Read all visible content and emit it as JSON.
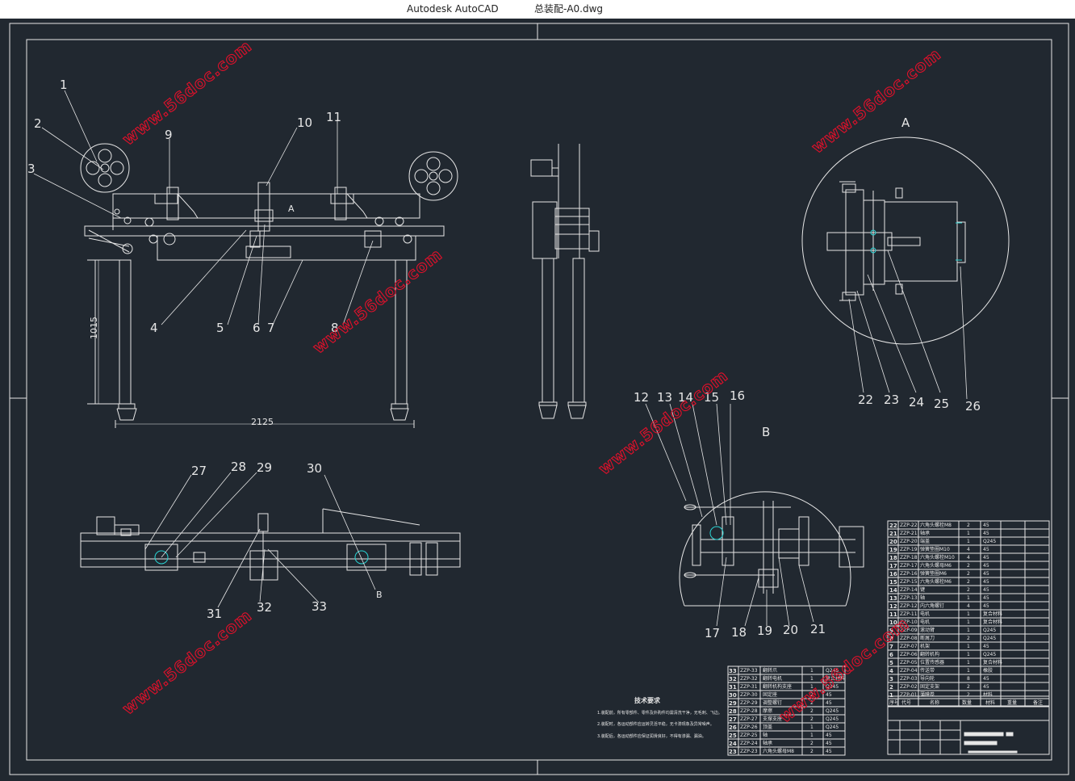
{
  "window": {
    "app_title": "Autodesk AutoCAD",
    "file_title": "总装配-A0.dwg"
  },
  "colors": {
    "background": "#212830",
    "line": "#e6e6e6",
    "accent": "#2ad4d4",
    "watermark": "#e0102a"
  },
  "watermark": {
    "text": "www.56doc.com"
  },
  "views": {
    "detail_a_label": "A",
    "detail_b_label": "B",
    "front_ref_label": "A",
    "top_ref_label": "B"
  },
  "dimensions": {
    "height": "1015",
    "width": "2125"
  },
  "callouts": {
    "c1": "1",
    "c2": "2",
    "c3": "3",
    "c4": "4",
    "c5": "5",
    "c6": "6",
    "c7": "7",
    "c8": "8",
    "c9": "9",
    "c10": "10",
    "c11": "11",
    "c12": "12",
    "c13": "13",
    "c14": "14",
    "c15": "15",
    "c16": "16",
    "c17": "17",
    "c18": "18",
    "c19": "19",
    "c20": "20",
    "c21": "21",
    "c22": "22",
    "c23": "23",
    "c24": "24",
    "c25": "25",
    "c26": "26",
    "c27": "27",
    "c28": "28",
    "c29": "29",
    "c30": "30",
    "c31": "31",
    "c32": "32",
    "c33": "33"
  },
  "tech_notes": {
    "title": "技术要求",
    "lines": [
      "1.装配前，所有零部件、零件及外购件均需清洗干净，无毛刺、飞边。",
      "2.装配时，各运动部件应运转灵活平稳，无卡滞现象及异常噪声。",
      "3.装配后，各运动部件应保证润滑良好，不得有渗漏、漏油。"
    ]
  },
  "bom_right": {
    "rows": [
      {
        "no": "22",
        "code": "ZZP-22",
        "name": "六角头螺栓M8",
        "qty": "2",
        "mat": "45"
      },
      {
        "no": "21",
        "code": "ZZP-21",
        "name": "轴承",
        "qty": "1",
        "mat": "45"
      },
      {
        "no": "20",
        "code": "ZZP-20",
        "name": "端盖",
        "qty": "1",
        "mat": "Q245"
      },
      {
        "no": "19",
        "code": "ZZP-19",
        "name": "弹簧垫圈M10",
        "qty": "4",
        "mat": "45"
      },
      {
        "no": "18",
        "code": "ZZP-18",
        "name": "六角头螺栓M10",
        "qty": "4",
        "mat": "45"
      },
      {
        "no": "17",
        "code": "ZZP-17",
        "name": "六角头螺母M6",
        "qty": "2",
        "mat": "45"
      },
      {
        "no": "16",
        "code": "ZZP-16",
        "name": "弹簧垫圈M6",
        "qty": "2",
        "mat": "45"
      },
      {
        "no": "15",
        "code": "ZZP-15",
        "name": "六角头螺栓M6",
        "qty": "2",
        "mat": "45"
      },
      {
        "no": "14",
        "code": "ZZP-14",
        "name": "键",
        "qty": "2",
        "mat": "45"
      },
      {
        "no": "13",
        "code": "ZZP-13",
        "name": "轴",
        "qty": "1",
        "mat": "45"
      },
      {
        "no": "12",
        "code": "ZZP-12",
        "name": "内六角螺钉",
        "qty": "4",
        "mat": "45"
      },
      {
        "no": "11",
        "code": "ZZP-11",
        "name": "电机",
        "qty": "1",
        "mat": "复合材料"
      },
      {
        "no": "10",
        "code": "ZZP-10",
        "name": "电机",
        "qty": "1",
        "mat": "复合材料"
      },
      {
        "no": "9",
        "code": "ZZP-09",
        "name": "滚动臂",
        "qty": "1",
        "mat": "Q245"
      },
      {
        "no": "8",
        "code": "ZZP-08",
        "name": "断屑刀",
        "qty": "2",
        "mat": "Q245"
      },
      {
        "no": "7",
        "code": "ZZP-07",
        "name": "机架",
        "qty": "1",
        "mat": "45"
      },
      {
        "no": "6",
        "code": "ZZP-06",
        "name": "翻转机构",
        "qty": "1",
        "mat": "Q245"
      },
      {
        "no": "5",
        "code": "ZZP-05",
        "name": "位置传感器",
        "qty": "1",
        "mat": "复合材料"
      },
      {
        "no": "4",
        "code": "ZZP-04",
        "name": "传送带",
        "qty": "1",
        "mat": "橡胶"
      },
      {
        "no": "3",
        "code": "ZZP-03",
        "name": "导向轮",
        "qty": "8",
        "mat": "45"
      },
      {
        "no": "2",
        "code": "ZZP-02",
        "name": "固定支架",
        "qty": "2",
        "mat": "45"
      },
      {
        "no": "1",
        "code": "ZZP-01",
        "name": "薄膜卷",
        "qty": "2",
        "mat": "材料"
      }
    ],
    "header": {
      "no": "序号",
      "code": "代号",
      "name": "名称",
      "qty": "数量",
      "mat": "材料",
      "weight": "重量",
      "remark": "备注"
    }
  },
  "bom_left": {
    "rows": [
      {
        "no": "33",
        "code": "ZZP-33",
        "name": "翻转爪",
        "qty": "1",
        "mat": "Q245"
      },
      {
        "no": "32",
        "code": "ZZP-32",
        "name": "翻转电机",
        "qty": "1",
        "mat": "复合材料"
      },
      {
        "no": "31",
        "code": "ZZP-31",
        "name": "翻转机构支座",
        "qty": "1",
        "mat": "Q245"
      },
      {
        "no": "30",
        "code": "ZZP-30",
        "name": "固定座",
        "qty": "2",
        "mat": "45"
      },
      {
        "no": "29",
        "code": "ZZP-29",
        "name": "调整螺钉",
        "qty": "2",
        "mat": "45"
      },
      {
        "no": "28",
        "code": "ZZP-28",
        "name": "摩擦",
        "qty": "2",
        "mat": "Q245"
      },
      {
        "no": "27",
        "code": "ZZP-27",
        "name": "支撑支座",
        "qty": "2",
        "mat": "Q245"
      },
      {
        "no": "26",
        "code": "ZZP-26",
        "name": "顶盖",
        "qty": "1",
        "mat": "Q245"
      },
      {
        "no": "25",
        "code": "ZZP-25",
        "name": "轴",
        "qty": "1",
        "mat": "45"
      },
      {
        "no": "24",
        "code": "ZZP-24",
        "name": "轴承",
        "qty": "2",
        "mat": "45"
      },
      {
        "no": "23",
        "code": "ZZP-23",
        "name": "六角头螺母M8",
        "qty": "2",
        "mat": "45"
      }
    ]
  }
}
